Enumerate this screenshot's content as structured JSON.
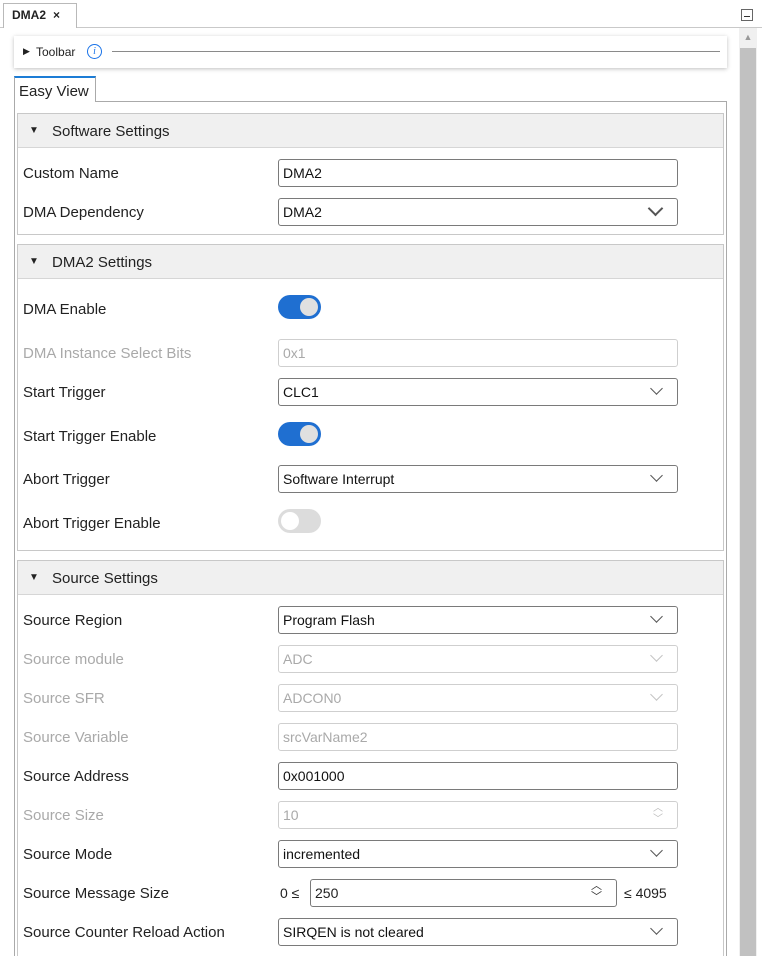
{
  "tab": {
    "title": "DMA2",
    "close": "×"
  },
  "toolbar": {
    "label": "Toolbar",
    "info": "i"
  },
  "view_tab": "Easy View",
  "software": {
    "title": "Software Settings",
    "custom_name_label": "Custom Name",
    "custom_name_value": "DMA2",
    "dependency_label": "DMA Dependency",
    "dependency_value": "DMA2"
  },
  "dma2": {
    "title": "DMA2 Settings",
    "enable_label": "DMA Enable",
    "enable_on": true,
    "instance_label": "DMA Instance Select Bits",
    "instance_value": "0x1",
    "start_trigger_label": "Start Trigger",
    "start_trigger_value": "CLC1",
    "start_trigger_enable_label": "Start Trigger Enable",
    "start_trigger_enable_on": true,
    "abort_trigger_label": "Abort Trigger",
    "abort_trigger_value": "Software Interrupt",
    "abort_trigger_enable_label": "Abort Trigger Enable",
    "abort_trigger_enable_on": false
  },
  "source": {
    "title": "Source Settings",
    "region_label": "Source Region",
    "region_value": "Program Flash",
    "module_label": "Source module",
    "module_value": "ADC",
    "sfr_label": "Source SFR",
    "sfr_value": "ADCON0",
    "variable_label": "Source Variable",
    "variable_value": "srcVarName2",
    "address_label": "Source Address",
    "address_value": "0x001000",
    "size_label": "Source Size",
    "size_value": "10",
    "mode_label": "Source Mode",
    "mode_value": "incremented",
    "message_size_label": "Source Message Size",
    "message_size_min": "0 ≤",
    "message_size_value": "250",
    "message_size_max": "≤ 4095",
    "reload_label": "Source Counter Reload Action",
    "reload_value": "SIRQEN is not cleared"
  }
}
